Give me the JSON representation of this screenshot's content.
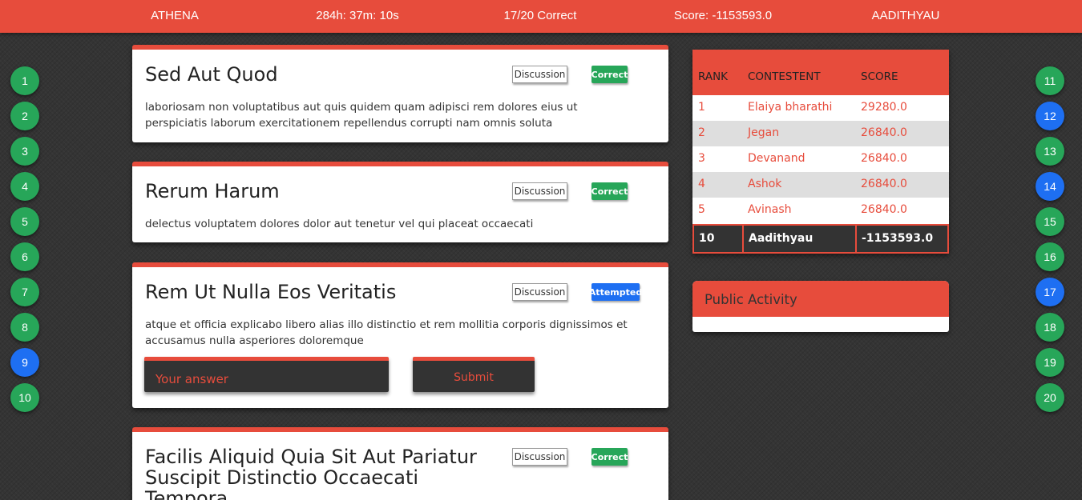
{
  "topbar": {
    "team": "ATHENA",
    "timer": "284h: 37m: 10s",
    "correct": "17/20 Correct",
    "score": "Score: -1153593.0",
    "user": "AADITHYAU"
  },
  "colors": {
    "accent": "#e74c3c",
    "correct": "#27a659",
    "attempted": "#1e6ff2",
    "dark": "#333333"
  },
  "question_nav": {
    "left": [
      {
        "num": "1",
        "status": "correct"
      },
      {
        "num": "2",
        "status": "correct"
      },
      {
        "num": "3",
        "status": "correct"
      },
      {
        "num": "4",
        "status": "correct"
      },
      {
        "num": "5",
        "status": "correct"
      },
      {
        "num": "6",
        "status": "correct"
      },
      {
        "num": "7",
        "status": "correct"
      },
      {
        "num": "8",
        "status": "correct"
      },
      {
        "num": "9",
        "status": "attempted"
      },
      {
        "num": "10",
        "status": "correct"
      }
    ],
    "right": [
      {
        "num": "11",
        "status": "correct"
      },
      {
        "num": "12",
        "status": "attempted"
      },
      {
        "num": "13",
        "status": "correct"
      },
      {
        "num": "14",
        "status": "attempted"
      },
      {
        "num": "15",
        "status": "correct"
      },
      {
        "num": "16",
        "status": "correct"
      },
      {
        "num": "17",
        "status": "attempted"
      },
      {
        "num": "18",
        "status": "correct"
      },
      {
        "num": "19",
        "status": "correct"
      },
      {
        "num": "20",
        "status": "correct"
      }
    ]
  },
  "questions": [
    {
      "title": "Sed Aut Quod",
      "description": "laboriosam non voluptatibus aut quis quidem quam adipisci rem dolores eius ut perspiciatis laborum exercitationem repellendus corrupti nam omnis soluta",
      "discussion_label": "Discussion",
      "status_label": "Correct"
    },
    {
      "title": "Rerum Harum",
      "description": "delectus voluptatem dolores dolor aut tenetur vel qui placeat occaecati",
      "discussion_label": "Discussion",
      "status_label": "Correct"
    },
    {
      "title": "Rem Ut Nulla Eos Veritatis",
      "description": "atque et officia explicabo libero alias illo distinctio et rem mollitia corporis dignissimos et accusamus nulla asperiores doloremque",
      "discussion_label": "Discussion",
      "status_label": "Attempted",
      "answer_placeholder": "Your answer",
      "answer_value": "",
      "submit_label": "Submit"
    },
    {
      "title": "Facilis Aliquid Quia Sit Aut Pariatur Suscipit Distinctio Occaecati Tempora",
      "discussion_label": "Discussion",
      "status_label": "Correct"
    }
  ],
  "leaderboard": {
    "headers": [
      "RANK",
      "CONTESTENT",
      "SCORE"
    ],
    "rows": [
      {
        "rank": "1",
        "name": "Elaiya bharathi",
        "score": "29280.0"
      },
      {
        "rank": "2",
        "name": "Jegan",
        "score": "26840.0"
      },
      {
        "rank": "3",
        "name": "Devanand",
        "score": "26840.0"
      },
      {
        "rank": "4",
        "name": "Ashok",
        "score": "26840.0"
      },
      {
        "rank": "5",
        "name": "Avinash",
        "score": "26840.0"
      }
    ],
    "current_user": {
      "rank": "10",
      "name": "Aadithyau",
      "score": "-1153593.0"
    }
  },
  "public_activity": {
    "title": "Public Activity"
  }
}
